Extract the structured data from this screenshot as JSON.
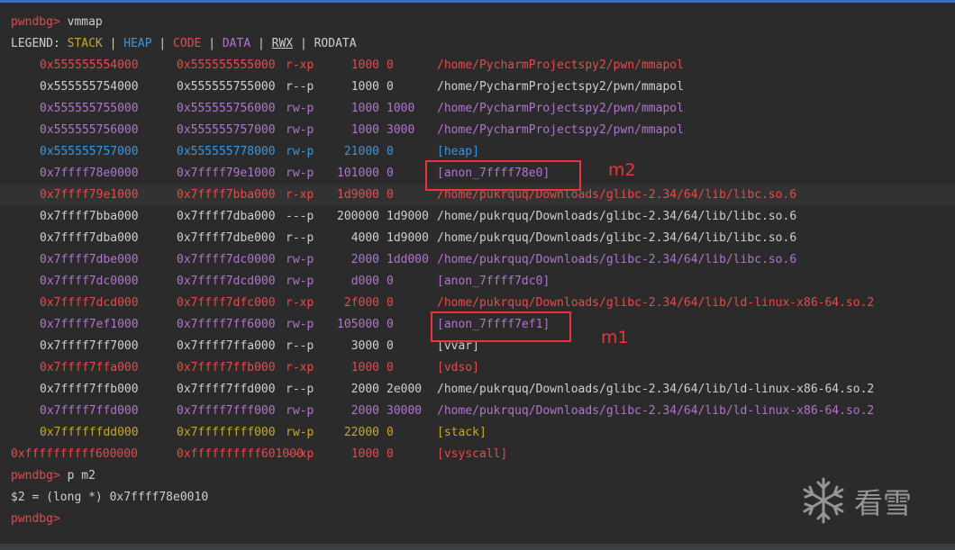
{
  "prompt": "pwndbg>",
  "command_1": "vmmap",
  "legend": {
    "label": "LEGEND:",
    "items": [
      {
        "text": "STACK",
        "color": "#c9a627"
      },
      {
        "text": "HEAP",
        "color": "#3a96dd"
      },
      {
        "text": "CODE",
        "color": "#e84a4a"
      },
      {
        "text": "DATA",
        "color": "#b074cd"
      },
      {
        "text": "RWX",
        "color": "#cfcfcf"
      },
      {
        "text": "RODATA",
        "color": "#cfcfcf"
      }
    ],
    "separator": "|"
  },
  "mappings": [
    {
      "start": "0x555555554000",
      "end": "0x555555555000",
      "perm": "r-xp",
      "size": "1000",
      "offset": "0",
      "path": "/home/PycharmProjectspy2/pwn/mmapol",
      "color": "#e84a4a"
    },
    {
      "start": "0x555555754000",
      "end": "0x555555755000",
      "perm": "r--p",
      "size": "1000",
      "offset": "0",
      "path": "/home/PycharmProjectspy2/pwn/mmapol",
      "color": "#cfcfcf"
    },
    {
      "start": "0x555555755000",
      "end": "0x555555756000",
      "perm": "rw-p",
      "size": "1000",
      "offset": "1000",
      "path": "/home/PycharmProjectspy2/pwn/mmapol",
      "color": "#b074cd"
    },
    {
      "start": "0x555555756000",
      "end": "0x555555757000",
      "perm": "rw-p",
      "size": "1000",
      "offset": "3000",
      "path": "/home/PycharmProjectspy2/pwn/mmapol",
      "color": "#b074cd"
    },
    {
      "start": "0x555555757000",
      "end": "0x555555778000",
      "perm": "rw-p",
      "size": "21000",
      "offset": "0",
      "path": "[heap]",
      "color": "#3a96dd"
    },
    {
      "start": "0x7ffff78e0000",
      "end": "0x7ffff79e1000",
      "perm": "rw-p",
      "size": "101000",
      "offset": "0",
      "path": "[anon_7ffff78e0]",
      "color": "#b074cd"
    },
    {
      "start": "0x7ffff79e1000",
      "end": "0x7ffff7bba000",
      "perm": "r-xp",
      "size": "1d9000",
      "offset": "0",
      "path": "/home/pukrquq/Downloads/glibc-2.34/64/lib/libc.so.6",
      "color": "#e84a4a"
    },
    {
      "start": "0x7ffff7bba000",
      "end": "0x7ffff7dba000",
      "perm": "---p",
      "size": "200000",
      "offset": "1d9000",
      "path": "/home/pukrquq/Downloads/glibc-2.34/64/lib/libc.so.6",
      "color": "#cfcfcf"
    },
    {
      "start": "0x7ffff7dba000",
      "end": "0x7ffff7dbe000",
      "perm": "r--p",
      "size": "4000",
      "offset": "1d9000",
      "path": "/home/pukrquq/Downloads/glibc-2.34/64/lib/libc.so.6",
      "color": "#cfcfcf"
    },
    {
      "start": "0x7ffff7dbe000",
      "end": "0x7ffff7dc0000",
      "perm": "rw-p",
      "size": "2000",
      "offset": "1dd000",
      "path": "/home/pukrquq/Downloads/glibc-2.34/64/lib/libc.so.6",
      "color": "#b074cd"
    },
    {
      "start": "0x7ffff7dc0000",
      "end": "0x7ffff7dcd000",
      "perm": "rw-p",
      "size": "d000",
      "offset": "0",
      "path": "[anon_7ffff7dc0]",
      "color": "#b074cd"
    },
    {
      "start": "0x7ffff7dcd000",
      "end": "0x7ffff7dfc000",
      "perm": "r-xp",
      "size": "2f000",
      "offset": "0",
      "path": "/home/pukrquq/Downloads/glibc-2.34/64/lib/ld-linux-x86-64.so.2",
      "color": "#e84a4a"
    },
    {
      "start": "0x7ffff7ef1000",
      "end": "0x7ffff7ff6000",
      "perm": "rw-p",
      "size": "105000",
      "offset": "0",
      "path": "[anon_7ffff7ef1]",
      "color": "#b074cd"
    },
    {
      "start": "0x7ffff7ff7000",
      "end": "0x7ffff7ffa000",
      "perm": "r--p",
      "size": "3000",
      "offset": "0",
      "path": "[vvar]",
      "color": "#cfcfcf"
    },
    {
      "start": "0x7ffff7ffa000",
      "end": "0x7ffff7ffb000",
      "perm": "r-xp",
      "size": "1000",
      "offset": "0",
      "path": "[vdso]",
      "color": "#e84a4a"
    },
    {
      "start": "0x7ffff7ffb000",
      "end": "0x7ffff7ffd000",
      "perm": "r--p",
      "size": "2000",
      "offset": "2e000",
      "path": "/home/pukrquq/Downloads/glibc-2.34/64/lib/ld-linux-x86-64.so.2",
      "color": "#cfcfcf"
    },
    {
      "start": "0x7ffff7ffd000",
      "end": "0x7ffff7fff000",
      "perm": "rw-p",
      "size": "2000",
      "offset": "30000",
      "path": "/home/pukrquq/Downloads/glibc-2.34/64/lib/ld-linux-x86-64.so.2",
      "color": "#b074cd"
    },
    {
      "start": "0x7ffffffdd000",
      "end": "0x7ffffffff000",
      "perm": "rw-p",
      "size": "22000",
      "offset": "0",
      "path": "[stack]",
      "color": "#c9a627"
    },
    {
      "start": "0xffffffffff600000",
      "end": "0xffffffffff601000",
      "perm": "--xp",
      "size": "1000",
      "offset": "0",
      "path": "[vsyscall]",
      "color": "#e84a4a"
    }
  ],
  "command_2": "p m2",
  "print_result": "$2 = (long *) 0x7ffff78e0010",
  "annotations": {
    "m2": "m2",
    "m1": "m1"
  },
  "watermark": {
    "text": "看雪",
    "icon": "snowflake-icon"
  }
}
